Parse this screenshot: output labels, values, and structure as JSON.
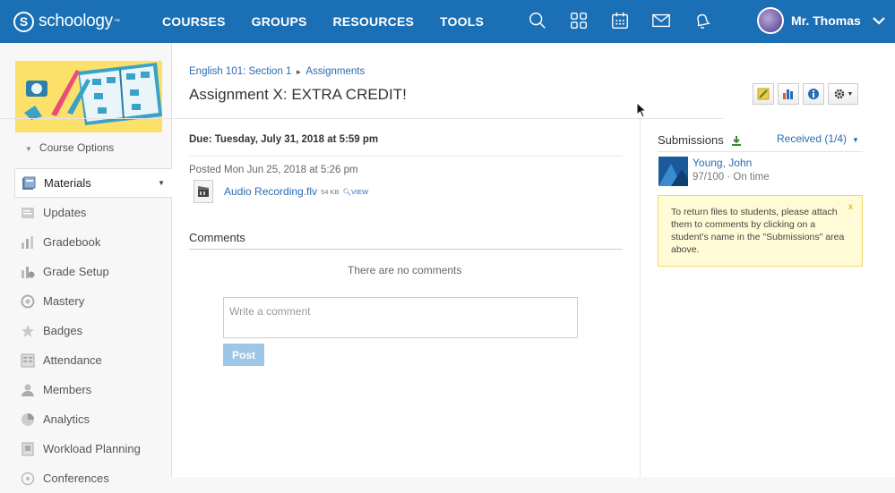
{
  "nav": {
    "logo_text": "schoology",
    "logo_mark": "S",
    "links": [
      "COURSES",
      "GROUPS",
      "RESOURCES",
      "TOOLS"
    ],
    "icons": [
      "search-icon",
      "apps-grid-icon",
      "calendar-icon",
      "mail-icon",
      "notifications-bell-icon"
    ],
    "user_name": "Mr. Thomas"
  },
  "sidebar": {
    "course_options": "Course Options",
    "items": [
      {
        "label": "Materials",
        "icon": "materials-icon",
        "active": true
      },
      {
        "label": "Updates",
        "icon": "updates-icon"
      },
      {
        "label": "Gradebook",
        "icon": "gradebook-icon"
      },
      {
        "label": "Grade Setup",
        "icon": "grade-setup-icon"
      },
      {
        "label": "Mastery",
        "icon": "mastery-icon"
      },
      {
        "label": "Badges",
        "icon": "badges-icon"
      },
      {
        "label": "Attendance",
        "icon": "attendance-icon"
      },
      {
        "label": "Members",
        "icon": "members-icon"
      },
      {
        "label": "Analytics",
        "icon": "analytics-icon"
      },
      {
        "label": "Workload Planning",
        "icon": "workload-planning-icon"
      },
      {
        "label": "Conferences",
        "icon": "conferences-icon"
      }
    ]
  },
  "main": {
    "breadcrumb": {
      "course": "English 101: Section 1",
      "section": "Assignments"
    },
    "title": "Assignment X: EXTRA CREDIT!",
    "due": "Due: Tuesday, July 31, 2018 at 5:59 pm",
    "posted": "Posted Mon Jun 25, 2018 at 5:26 pm",
    "file": {
      "name": "Audio Recording.flv",
      "size": "54 KB",
      "view": "VIEW"
    },
    "comments_heading": "Comments",
    "no_comments": "There are no comments",
    "comment_placeholder": "Write a comment",
    "post_label": "Post"
  },
  "submissions": {
    "heading": "Submissions",
    "received": "Received (1/4)",
    "student_name": "Young, John",
    "student_score": "97/100 · On time",
    "notice": "To return files to students, please attach them to comments by clicking on a student's name in the \"Submissions\" area above.",
    "notice_close": "x"
  },
  "colors": {
    "brand": "#1a6fb5",
    "link": "#2a6cb3",
    "notice_bg": "#fffbd6"
  }
}
